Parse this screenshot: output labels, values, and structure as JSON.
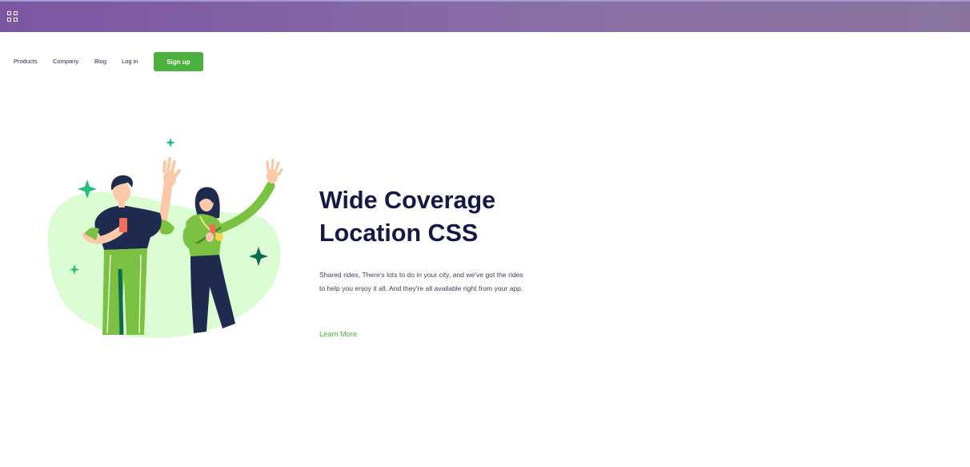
{
  "topbar": {
    "icon": "apps-grid-icon",
    "color": "#7c56a3"
  },
  "nav": {
    "items": [
      {
        "label": "Products"
      },
      {
        "label": "Company"
      },
      {
        "label": "Blog"
      },
      {
        "label": "Log in"
      }
    ],
    "signup_label": "Sign up",
    "signup_color": "#4bb03d"
  },
  "hero": {
    "title_line1": "Wide Coverage",
    "title_line2": "Location CSS",
    "description": "Shared rides, There's lots to do in your city, and we've got the rides to help you enjoy it all. And they're all available right from your app.",
    "cta_label": "Learn More",
    "title_color": "#141a45",
    "accent_color": "#4bb03d"
  }
}
